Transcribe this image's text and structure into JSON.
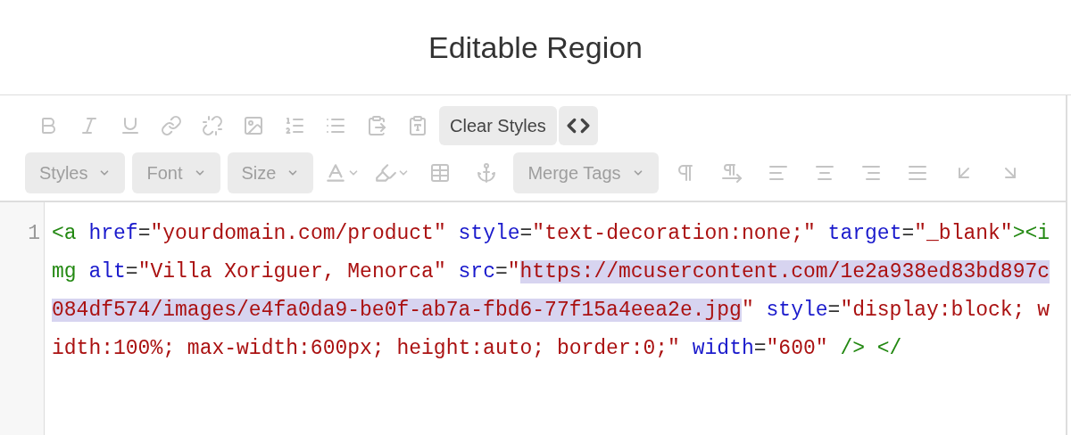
{
  "title": "Editable Region",
  "toolbar": {
    "rows": [
      [
        {
          "kind": "icon",
          "disabled": true
        },
        {
          "kind": "icon",
          "disabled": true
        },
        {
          "kind": "icon",
          "disabled": true
        },
        {
          "kind": "icon",
          "disabled": true
        },
        {
          "kind": "icon",
          "disabled": true
        },
        {
          "kind": "icon",
          "disabled": true
        },
        {
          "kind": "icon",
          "disabled": true
        },
        {
          "kind": "icon",
          "disabled": true
        },
        {
          "kind": "icon",
          "disabled": true
        },
        {
          "kind": "icon",
          "disabled": true
        },
        {
          "kind": "button",
          "label": "Clear Styles",
          "disabled": false
        },
        {
          "kind": "icon-button",
          "disabled": false
        }
      ],
      [
        {
          "kind": "dropdown",
          "label": "Styles",
          "disabled": true
        },
        {
          "kind": "dropdown",
          "label": "Font",
          "disabled": true
        },
        {
          "kind": "dropdown",
          "label": "Size",
          "disabled": true
        },
        {
          "kind": "icon-dropdown",
          "disabled": true
        },
        {
          "kind": "icon-dropdown",
          "disabled": true
        },
        {
          "kind": "icon",
          "disabled": true
        },
        {
          "kind": "icon",
          "disabled": true
        },
        {
          "kind": "dropdown",
          "label": "Merge Tags",
          "disabled": true
        },
        {
          "kind": "icon",
          "disabled": true
        },
        {
          "kind": "icon",
          "disabled": true
        },
        {
          "kind": "icon",
          "disabled": true
        },
        {
          "kind": "icon",
          "disabled": true
        },
        {
          "kind": "icon",
          "disabled": true
        },
        {
          "kind": "icon",
          "disabled": true
        },
        {
          "kind": "icon",
          "disabled": true
        },
        {
          "kind": "icon",
          "disabled": true
        }
      ]
    ]
  },
  "code": {
    "line_number": "1",
    "tokens": [
      {
        "kind": "tag",
        "text": "<a ",
        "selected": false
      },
      {
        "kind": "attr",
        "text": "href",
        "selected": false
      },
      {
        "kind": "plain",
        "text": "=",
        "selected": false
      },
      {
        "kind": "string",
        "text": "\"yourdomain.com/product\"",
        "selected": false
      },
      {
        "kind": "attr",
        "text": " style",
        "selected": false
      },
      {
        "kind": "plain",
        "text": "=",
        "selected": false
      },
      {
        "kind": "string",
        "text": "\"text-decoration:none;\"",
        "selected": false
      },
      {
        "kind": "attr",
        "text": " target",
        "selected": false
      },
      {
        "kind": "plain",
        "text": "=",
        "selected": false
      },
      {
        "kind": "string",
        "text": "\"_blank\"",
        "selected": false
      },
      {
        "kind": "tag",
        "text": "><img ",
        "selected": false
      },
      {
        "kind": "attr",
        "text": "alt",
        "selected": false
      },
      {
        "kind": "plain",
        "text": "=",
        "selected": false
      },
      {
        "kind": "string",
        "text": "\"Villa Xoriguer, Menorca\"",
        "selected": false
      },
      {
        "kind": "attr",
        "text": " src",
        "selected": false
      },
      {
        "kind": "plain",
        "text": "=",
        "selected": false
      },
      {
        "kind": "string",
        "text": "\"",
        "selected": false
      },
      {
        "kind": "string",
        "text": "https://mcusercontent.com/1e2a938ed83bd897c084df574/images/e4fa0da9-be0f-ab7a-fbd6-77f15a4eea2e.jpg",
        "selected": true
      },
      {
        "kind": "string",
        "text": "\"",
        "selected": false
      },
      {
        "kind": "attr",
        "text": " style",
        "selected": false
      },
      {
        "kind": "plain",
        "text": "=",
        "selected": false
      },
      {
        "kind": "string",
        "text": "\"display:block; width:100%; max-width:600px; height:auto; border:0;\"",
        "selected": false
      },
      {
        "kind": "attr",
        "text": " width",
        "selected": false
      },
      {
        "kind": "plain",
        "text": "=",
        "selected": false
      },
      {
        "kind": "string",
        "text": "\"600\"",
        "selected": false
      },
      {
        "kind": "tag",
        "text": " /> </",
        "selected": false
      }
    ]
  }
}
